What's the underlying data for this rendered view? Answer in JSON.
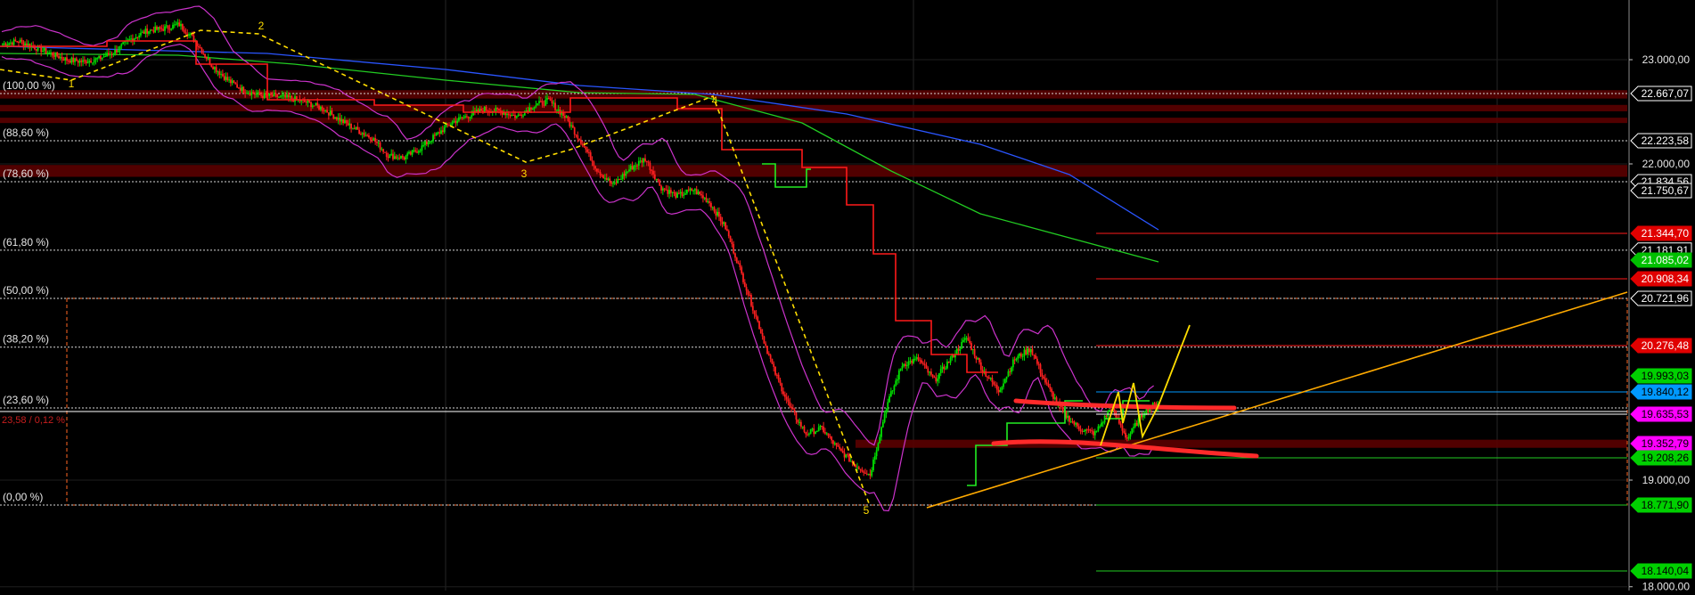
{
  "chart_data": {
    "type": "candlestick",
    "y_axis": {
      "ticks": [
        "23.000,00",
        "22.000,00",
        "19.000,00",
        "18.000,00"
      ],
      "tick_values": [
        23000,
        22000,
        19000,
        18000
      ],
      "ylim": [
        17980,
        23550
      ]
    },
    "fibonacci_levels": [
      {
        "label": "(100,00 %)",
        "price": 22667.07
      },
      {
        "label": "(88,60 %)",
        "price": 22223.58
      },
      {
        "label": "(78,60 %)",
        "price": 21834.56
      },
      {
        "label": "(61,80 %)",
        "price": 21181.0
      },
      {
        "label": "(50,00 %)",
        "price": 20721.96
      },
      {
        "label": "(38,20 %)",
        "price": 20262.0
      },
      {
        "label": "(23,60 %)",
        "price": 19693.0
      },
      {
        "label": "(0,00 %)",
        "price": 18771.9
      }
    ],
    "fib_extra_label": "23,58 / 0,12 %",
    "wave_labels": [
      "1",
      "2",
      "3",
      "4",
      "5"
    ],
    "price_tags": [
      {
        "text": "22.667,07",
        "price": 22667.07,
        "bg": "#000000",
        "fg": "#ffffff",
        "border": "#ffffff"
      },
      {
        "text": "22.223,58",
        "price": 22223.58,
        "bg": "#000000",
        "fg": "#ffffff",
        "border": "#ffffff"
      },
      {
        "text": "21.834,56",
        "price": 21834.56,
        "bg": "#000000",
        "fg": "#ffffff",
        "border": "#ffffff"
      },
      {
        "text": "21.750,67",
        "price": 21750.67,
        "bg": "#000000",
        "fg": "#ffffff",
        "border": "#ffffff"
      },
      {
        "text": "21.344,70",
        "price": 21344.7,
        "bg": "#e00000",
        "fg": "#ffffff",
        "border": "#e00000"
      },
      {
        "text": "21.181,91",
        "price": 21181.91,
        "bg": "#000000",
        "fg": "#ffffff",
        "border": "#ffffff"
      },
      {
        "text": "21.085,02",
        "price": 21085.02,
        "bg": "#00c000",
        "fg": "#ffffff",
        "border": "#00c000"
      },
      {
        "text": "20.908,34",
        "price": 20908.34,
        "bg": "#e00000",
        "fg": "#ffffff",
        "border": "#e00000"
      },
      {
        "text": "20.721,96",
        "price": 20721.96,
        "bg": "#000000",
        "fg": "#ffffff",
        "border": "#ffffff"
      },
      {
        "text": "20.276,48",
        "price": 20276.48,
        "bg": "#e00000",
        "fg": "#ffffff",
        "border": "#e00000"
      },
      {
        "text": "19.993,03",
        "price": 19993.03,
        "bg": "#00d000",
        "fg": "#000000",
        "border": "#00d000"
      },
      {
        "text": "19.840,12",
        "price": 19840.12,
        "bg": "#0099ff",
        "fg": "#000000",
        "border": "#0099ff"
      },
      {
        "text": "19.635,53",
        "price": 19635.53,
        "bg": "#ff00ff",
        "fg": "#000000",
        "border": "#ff00ff"
      },
      {
        "text": "19.352,79",
        "price": 19352.79,
        "bg": "#ff00ff",
        "fg": "#000000",
        "border": "#ff00ff"
      },
      {
        "text": "19.208,26",
        "price": 19208.26,
        "bg": "#00d000",
        "fg": "#000000",
        "border": "#00d000"
      },
      {
        "text": "18.771,90",
        "price": 18771.9,
        "bg": "#00d000",
        "fg": "#000000",
        "border": "#00d000"
      },
      {
        "text": "18.140,04",
        "price": 18140.04,
        "bg": "#00d000",
        "fg": "#000000",
        "border": "#00d000"
      }
    ],
    "price_path": [
      23150,
      23180,
      23120,
      23060,
      23000,
      22980,
      23010,
      23080,
      23200,
      23280,
      23300,
      23340,
      23180,
      22950,
      22800,
      22700,
      22650,
      22640,
      22620,
      22580,
      22520,
      22420,
      22330,
      22250,
      22080,
      22060,
      22150,
      22280,
      22400,
      22460,
      22520,
      22500,
      22450,
      22550,
      22600,
      22450,
      22220,
      21950,
      21800,
      21950,
      22050,
      21780,
      21700,
      21760,
      21640,
      21400,
      20950,
      20500,
      20050,
      19700,
      19450,
      19500,
      19300,
      19150,
      19050,
      19700,
      20100,
      20150,
      19950,
      20150,
      20350,
      20050,
      19850,
      20150,
      20250,
      19900,
      19650,
      19500,
      19450,
      19700,
      19400,
      19650,
      19750
    ],
    "colors": {
      "up": "#00e000",
      "down": "#ff2020",
      "ma_blue": "#2a55ff",
      "ma_green": "#22cc22",
      "bands": "#cc33cc",
      "supertrend_red": "#ff1a1a",
      "supertrend_green": "#22ee22",
      "trendline": "#ffaa00",
      "wave": "#ffdd00",
      "fib_box": "#ff6622"
    }
  }
}
